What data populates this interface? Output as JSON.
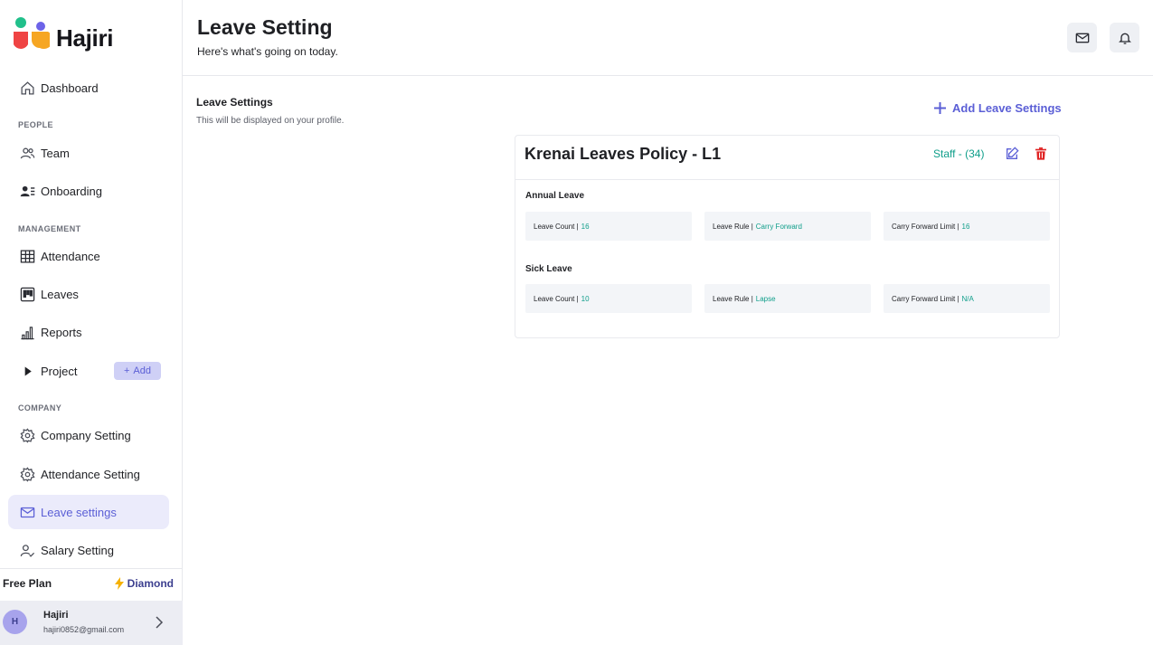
{
  "app": {
    "name": "Hajiri"
  },
  "sidebar": {
    "items": [
      {
        "label": "Dashboard",
        "icon": "home-icon"
      },
      {
        "label": "Team",
        "icon": "users-icon"
      },
      {
        "label": "Onboarding",
        "icon": "user-list-icon"
      },
      {
        "label": "Attendance",
        "icon": "table-icon"
      },
      {
        "label": "Leaves",
        "icon": "kanban-icon"
      },
      {
        "label": "Reports",
        "icon": "bar-chart-icon"
      },
      {
        "label": "Project",
        "icon": "play-icon"
      },
      {
        "label": "Company Setting",
        "icon": "gear-icon"
      },
      {
        "label": "Attendance Setting",
        "icon": "gear-icon"
      },
      {
        "label": "Leave settings",
        "icon": "mail-icon",
        "active": true
      },
      {
        "label": "Salary Setting",
        "icon": "user-check-icon"
      }
    ],
    "sections": {
      "people": "PEOPLE",
      "management": "MANAGEMENT",
      "company": "COMPANY"
    },
    "project_add_label": "Add",
    "plan": {
      "name": "Free Plan",
      "tier": "Diamond"
    },
    "user": {
      "initial": "H",
      "name": "Hajiri",
      "email": "hajiri0852@gmail.com"
    }
  },
  "header": {
    "title": "Leave Setting",
    "subtitle": "Here's what's going on today."
  },
  "content": {
    "section_title": "Leave Settings",
    "section_subtitle": "This will be displayed on your profile.",
    "add_button_label": "Add Leave Settings",
    "policy": {
      "name": "Krenai Leaves Policy - L1",
      "staff_label": "Staff - (34)",
      "leaves": [
        {
          "title": "Annual Leave",
          "count_label": "Leave Count |",
          "count": "16",
          "rule_label": "Leave Rule |",
          "rule": "Carry Forward",
          "limit_label": "Carry Forward Limit |",
          "limit": "16"
        },
        {
          "title": "Sick Leave",
          "count_label": "Leave Count |",
          "count": "10",
          "rule_label": "Leave Rule |",
          "rule": "Lapse",
          "limit_label": "Carry Forward Limit |",
          "limit": "N/A"
        }
      ]
    }
  },
  "colors": {
    "accent": "#5b5fd6",
    "teal": "#0f9e8a",
    "danger": "#e02424",
    "active_bg": "#ebebfb"
  }
}
